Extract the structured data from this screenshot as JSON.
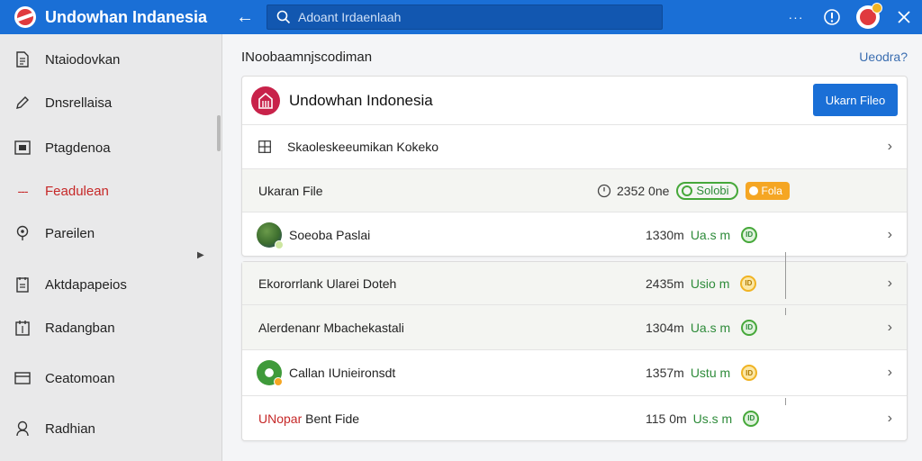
{
  "app": {
    "title": "Undowhan Indanesia",
    "search_placeholder": "Adoant Irdaenlaah"
  },
  "sidebar": {
    "items": [
      {
        "label": "Ntaiodovkan",
        "icon": "document-icon"
      },
      {
        "label": "Dnsrellaisa",
        "icon": "pencil-icon"
      },
      {
        "label": "Ptagdenoa",
        "icon": "picture-icon"
      },
      {
        "label": "Feadulean",
        "icon": "dashes-icon",
        "active": true
      },
      {
        "label": "Pareilen",
        "icon": "location-pin-icon"
      },
      {
        "label": "Aktdapapeios",
        "icon": "clipboard-icon"
      },
      {
        "label": "Radangban",
        "icon": "calendar-icon"
      },
      {
        "label": "Ceatomoan",
        "icon": "credit-card-icon"
      },
      {
        "label": "Radhian",
        "icon": "person-icon"
      }
    ]
  },
  "main": {
    "section_title": "INoobaamnjscodiman",
    "top_link": "Ueodra?",
    "org": {
      "name": "Undowhan Indonesia",
      "button": "Ukarn Fileo"
    },
    "subheader": {
      "label": "Skaoleskeeumikan Kokeko"
    },
    "summary": {
      "label": "Ukaran File",
      "stat": "2352 0ne",
      "green_pill": "Solobi",
      "orange_pill": "Fola"
    },
    "first_item": {
      "name": "Soeoba Paslai",
      "size": "1330m",
      "unit": "Ua.s m",
      "badge": "ID"
    },
    "items": [
      {
        "name": "Ekororrlank Ularei Doteh",
        "size": "2435m",
        "unit": "Usio m",
        "badge": "ID",
        "badge_color": "yellow"
      },
      {
        "name": "Alerdenanr Mbachekastali",
        "size": "1304m",
        "unit": "Ua.s m",
        "badge": "ID",
        "badge_color": "green"
      },
      {
        "name": "Callan IUnieironsdt",
        "size": "1357m",
        "unit": "Ustu m",
        "badge": "ID",
        "badge_color": "yellow"
      },
      {
        "name_accent": "UNopar",
        "name_rest": "Bent Fide",
        "size": "115 0m",
        "unit": "Us.s m",
        "badge": "ID",
        "badge_color": "green"
      }
    ]
  },
  "colors": {
    "brand_blue": "#1a6fd6",
    "accent_red": "#c62828",
    "status_green": "#46a83a",
    "status_yellow": "#f0b323",
    "status_orange": "#f5a623"
  }
}
